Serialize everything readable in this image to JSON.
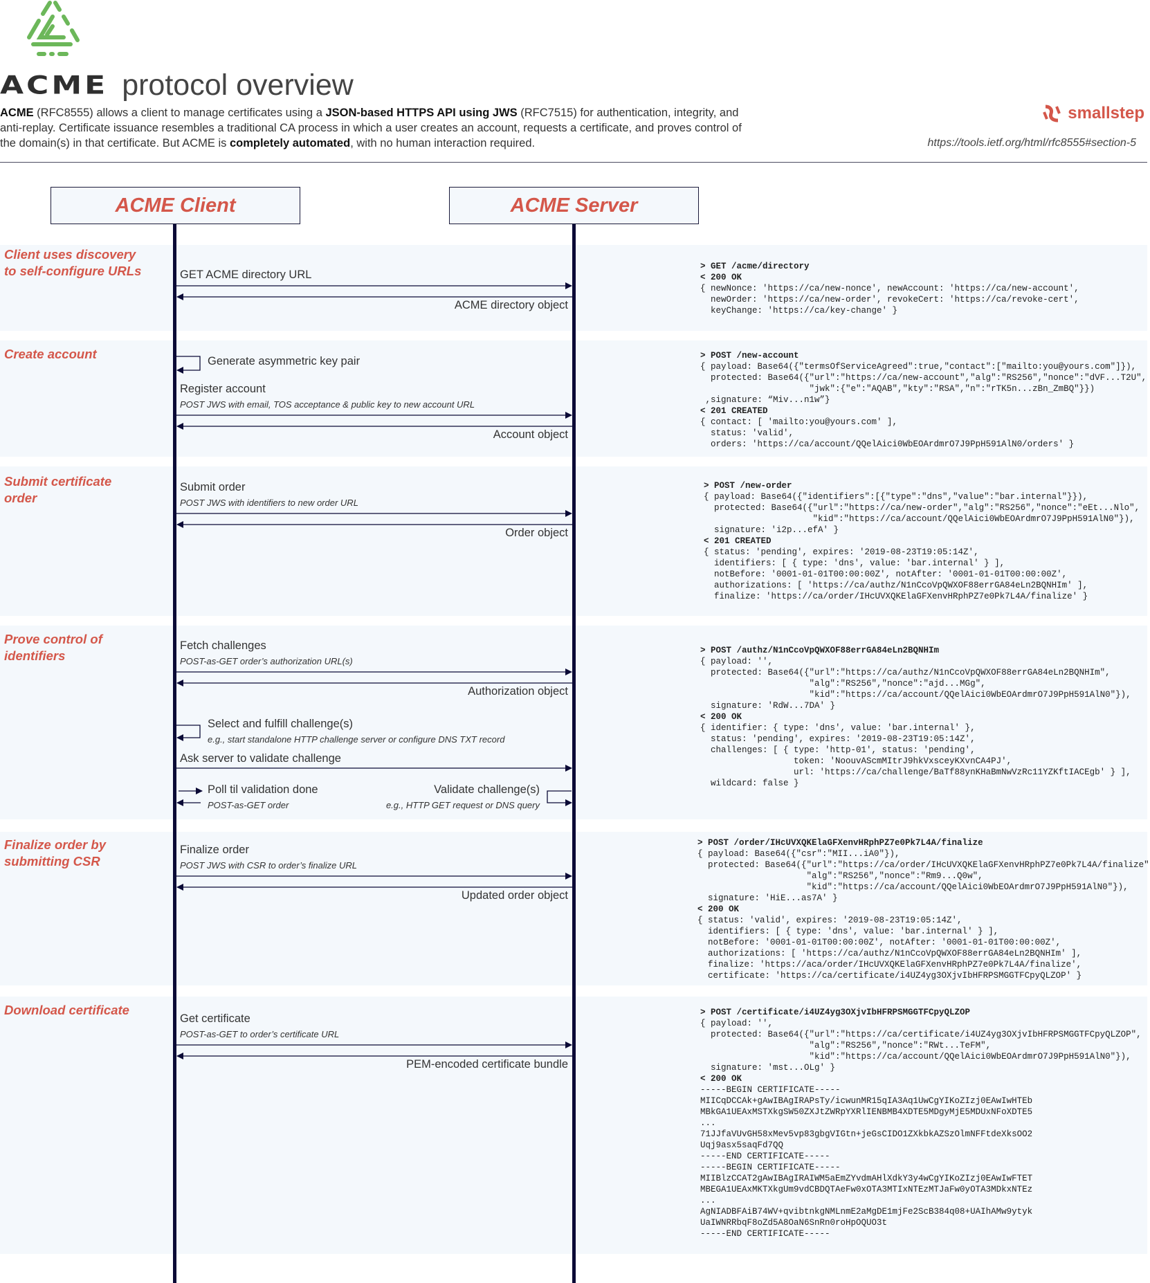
{
  "header": {
    "logo": "acme-triangle-logo",
    "title_word": "ACME",
    "title_rest": "protocol overview",
    "intro": [
      {
        "text": "ACME",
        "bold": true
      },
      {
        "text": " (RFC8555) allows a client to manage certificates using a ",
        "bold": false
      },
      {
        "text": "JSON-based HTTPS API using JWS",
        "bold": true
      },
      {
        "text": " (RFC7515) for authentication, integrity, and anti-replay. Certificate issuance resembles a traditional CA process in which a user creates an account, requests a certificate, and proves control of the domain(s) in that certificate. But ACME is ",
        "bold": false
      },
      {
        "text": "completely automated",
        "bold": true
      },
      {
        "text": ", with no human interaction required.",
        "bold": false
      }
    ],
    "brand": "smallstep",
    "reference_url": "https://tools.ietf.org/html/rfc8555#section-5"
  },
  "colors": {
    "accent": "#d4574a",
    "logo_green": "#6cb75a",
    "lifeline": "#0b0a36",
    "band": "#f4f8fc"
  },
  "actors": {
    "client": "ACME Client",
    "server": "ACME Server"
  },
  "sections": [
    {
      "title": "Client uses discovery to self-configure URLs",
      "messages": [
        {
          "label": "GET ACME directory URL",
          "direction": "to-server"
        },
        {
          "label": "ACME directory object",
          "direction": "to-client"
        }
      ],
      "code": [
        {
          "text": "> GET /acme/directory",
          "bold": true
        },
        {
          "text": "< 200 OK",
          "bold": true
        },
        {
          "text": "{ newNonce: 'https://ca/new-nonce', newAccount: 'https://ca/new-account',",
          "bold": false
        },
        {
          "text": "  newOrder: 'https://ca/new-order', revokeCert: 'https://ca/revoke-cert',",
          "bold": false
        },
        {
          "text": "  keyChange: 'https://ca/key-change' }",
          "bold": false
        }
      ]
    },
    {
      "title": "Create account",
      "messages": [
        {
          "label": "Generate asymmetric key pair",
          "direction": "self-client"
        },
        {
          "label": "Register account",
          "sub": "POST JWS with email, TOS acceptance & public key to new account URL",
          "direction": "to-server"
        },
        {
          "label": "Account object",
          "direction": "to-client"
        }
      ],
      "code": [
        {
          "text": "> POST /new-account",
          "bold": true
        },
        {
          "text": "{ payload: Base64({\"termsOfServiceAgreed\":true,\"contact\":[\"mailto:you@yours.com\"]}),",
          "bold": false
        },
        {
          "text": "  protected: Base64({\"url\":\"https://ca/new-account\",\"alg\":\"RS256\",\"nonce\":\"dVF...T2U\",",
          "bold": false
        },
        {
          "text": "                     \"jwk\":{\"e\":\"AQAB\",\"kty\":\"RSA\",\"n\":\"rTK5n...zBn_ZmBQ\"}})",
          "bold": false
        },
        {
          "text": " ,signature: “Miv...n1w”}",
          "bold": false
        },
        {
          "text": "< 201 CREATED",
          "bold": true
        },
        {
          "text": "{ contact: [ 'mailto:you@yours.com' ],",
          "bold": false
        },
        {
          "text": "  status: 'valid',",
          "bold": false
        },
        {
          "text": "  orders: 'https://ca/account/QQelAici0WbEOArdmrO7J9PpH591AlN0/orders' }",
          "bold": false
        }
      ]
    },
    {
      "title": "Submit certificate order",
      "messages": [
        {
          "label": "Submit order",
          "sub": "POST JWS with identifiers to new order URL",
          "direction": "to-server"
        },
        {
          "label": "Order object",
          "direction": "to-client"
        }
      ],
      "code": [
        {
          "text": "> POST /new-order",
          "bold": true
        },
        {
          "text": "{ payload: Base64({\"identifiers\":[{\"type\":\"dns\",\"value\":\"bar.internal\"}}),",
          "bold": false
        },
        {
          "text": "  protected: Base64({\"url\":\"https://ca/new-order\",\"alg\":\"RS256\",\"nonce\":\"eEt...Nlo\",",
          "bold": false
        },
        {
          "text": "                     \"kid\":\"https://ca/account/QQelAici0WbEOArdmrO7J9PpH591AlN0\"}),",
          "bold": false
        },
        {
          "text": "  signature: 'i2p...efA' }",
          "bold": false
        },
        {
          "text": "< 201 CREATED",
          "bold": true
        },
        {
          "text": "{ status: 'pending', expires: '2019-08-23T19:05:14Z',",
          "bold": false
        },
        {
          "text": "  identifiers: [ { type: 'dns', value: 'bar.internal' } ],",
          "bold": false
        },
        {
          "text": "  notBefore: '0001-01-01T00:00:00Z', notAfter: '0001-01-01T00:00:00Z',",
          "bold": false
        },
        {
          "text": "  authorizations: [ 'https://ca/authz/N1nCcoVpQWXOF88errGA84eLn2BQNHIm' ],",
          "bold": false
        },
        {
          "text": "  finalize: 'https://ca/order/IHcUVXQKElaGFXenvHRphPZ7e0Pk7L4A/finalize' }",
          "bold": false
        }
      ]
    },
    {
      "title": "Prove control of identifiers",
      "messages": [
        {
          "label": "Fetch challenges",
          "sub": "POST-as-GET order’s authorization URL(s)",
          "direction": "to-server"
        },
        {
          "label": "Authorization object",
          "direction": "to-client"
        },
        {
          "label": "Select and fulfill challenge(s)",
          "sub": "e.g., start standalone HTTP challenge server or configure DNS TXT record",
          "direction": "self-client"
        },
        {
          "label": "Ask server to validate challenge",
          "direction": "to-server"
        },
        {
          "label": "Poll til validation done",
          "sub": "POST-as-GET order",
          "direction": "poll-client"
        },
        {
          "label": "Validate challenge(s)",
          "sub": "e.g., HTTP GET request or DNS query",
          "direction": "self-server"
        }
      ],
      "code": [
        {
          "text": "> POST /authz/N1nCcoVpQWXOF88errGA84eLn2BQNHIm",
          "bold": true
        },
        {
          "text": "{ payload: '',",
          "bold": false
        },
        {
          "text": "  protected: Base64({\"url\":\"https://ca/authz/N1nCcoVpQWXOF88errGA84eLn2BQNHIm\",",
          "bold": false
        },
        {
          "text": "                     \"alg\":\"RS256\",\"nonce\":\"ajd...MGg\",",
          "bold": false
        },
        {
          "text": "                     \"kid\":\"https://ca/account/QQelAici0WbEOArdmrO7J9PpH591AlN0\"}),",
          "bold": false
        },
        {
          "text": "  signature: 'RdW...7DA' }",
          "bold": false
        },
        {
          "text": "< 200 OK",
          "bold": true
        },
        {
          "text": "{ identifier: { type: 'dns', value: 'bar.internal' },",
          "bold": false
        },
        {
          "text": "  status: 'pending', expires: '2019-08-23T19:05:14Z',",
          "bold": false
        },
        {
          "text": "  challenges: [ { type: 'http-01', status: 'pending',",
          "bold": false
        },
        {
          "text": "                  token: 'NoouvAScmMItrJ9hkVxsceyKXvnCA4PJ',",
          "bold": false
        },
        {
          "text": "                  url: 'https://ca/challenge/BaTf88ynKHaBmNwVzRc11YZKftIACEgb' } ],",
          "bold": false
        },
        {
          "text": "  wildcard: false }",
          "bold": false
        }
      ]
    },
    {
      "title": "Finalize order by submitting CSR",
      "messages": [
        {
          "label": "Finalize order",
          "sub": "POST JWS with CSR to order’s finalize URL",
          "direction": "to-server"
        },
        {
          "label": "Updated order object",
          "direction": "to-client"
        }
      ],
      "code": [
        {
          "text": "> POST /order/IHcUVXQKElaGFXenvHRphPZ7e0Pk7L4A/finalize",
          "bold": true
        },
        {
          "text": "{ payload: Base64({\"csr\":\"MII...iA0\"}),",
          "bold": false
        },
        {
          "text": "  protected: Base64({\"url\":\"https://ca/order/IHcUVXQKElaGFXenvHRphPZ7e0Pk7L4A/finalize\",",
          "bold": false
        },
        {
          "text": "                     \"alg\":\"RS256\",\"nonce\":\"Rm9...Q0w\",",
          "bold": false
        },
        {
          "text": "                     \"kid\":\"https://ca/account/QQelAici0WbEOArdmrO7J9PpH591AlN0\"}),",
          "bold": false
        },
        {
          "text": "  signature: 'HiE...as7A' }",
          "bold": false
        },
        {
          "text": "< 200 OK",
          "bold": true
        },
        {
          "text": "{ status: 'valid', expires: '2019-08-23T19:05:14Z',",
          "bold": false
        },
        {
          "text": "  identifiers: [ { type: 'dns', value: 'bar.internal' } ],",
          "bold": false
        },
        {
          "text": "  notBefore: '0001-01-01T00:00:00Z', notAfter: '0001-01-01T00:00:00Z',",
          "bold": false
        },
        {
          "text": "  authorizations: [ 'https://ca/authz/N1nCcoVpQWXOF88errGA84eLn2BQNHIm' ],",
          "bold": false
        },
        {
          "text": "  finalize: 'https://aca/order/IHcUVXQKElaGFXenvHRphPZ7e0Pk7L4A/finalize',",
          "bold": false
        },
        {
          "text": "  certificate: 'https://ca/certificate/i4UZ4yg3OXjvIbHFRPSMGGTFCpyQLZOP' }",
          "bold": false
        }
      ]
    },
    {
      "title": "Download certificate",
      "messages": [
        {
          "label": "Get certificate",
          "sub": "POST-as-GET to order’s certificate URL",
          "direction": "to-server"
        },
        {
          "label": "PEM-encoded certificate bundle",
          "direction": "to-client"
        }
      ],
      "code": [
        {
          "text": "> POST /certificate/i4UZ4yg3OXjvIbHFRPSMGGTFCpyQLZOP",
          "bold": true
        },
        {
          "text": "{ payload: '',",
          "bold": false
        },
        {
          "text": "  protected: Base64({\"url\":\"https://ca/certificate/i4UZ4yg3OXjvIbHFRPSMGGTFCpyQLZOP\",",
          "bold": false
        },
        {
          "text": "                     \"alg\":\"RS256\",\"nonce\":\"RWt...TeFM\",",
          "bold": false
        },
        {
          "text": "                     \"kid\":\"https://ca/account/QQelAici0WbEOArdmrO7J9PpH591AlN0\"}),",
          "bold": false
        },
        {
          "text": "  signature: 'mst...OLg' }",
          "bold": false
        },
        {
          "text": "< 200 OK",
          "bold": true
        },
        {
          "text": "-----BEGIN CERTIFICATE-----",
          "bold": false
        },
        {
          "text": "MIICqDCCAk+gAwIBAgIRAPsTy/icwunMR15qIA3Aq1UwCgYIKoZIzj0EAwIwHTEb",
          "bold": false
        },
        {
          "text": "MBkGA1UEAxMSTXkgSW50ZXJtZWRpYXRlIENBMB4XDTE5MDgyMjE5MDUxNFoXDTE5",
          "bold": false
        },
        {
          "text": "...",
          "bold": false
        },
        {
          "text": "71JJfaVUvGH58xMev5vp83gbgVIGtn+jeGsCIDO1ZXkbkAZSzOlmNFFtdeXksOO2",
          "bold": false
        },
        {
          "text": "Uqj9asx5saqFd7QQ",
          "bold": false
        },
        {
          "text": "-----END CERTIFICATE-----",
          "bold": false
        },
        {
          "text": "-----BEGIN CERTIFICATE-----",
          "bold": false
        },
        {
          "text": "MIIBlzCCAT2gAwIBAgIRAIWM5aEmZYvdmAHlXdkY3y4wCgYIKoZIzj0EAwIwFTET",
          "bold": false
        },
        {
          "text": "MBEGA1UEAxMKTXkgUm9vdCBDQTAeFw0xOTA3MTIxNTEzMTJaFw0yOTA3MDkxNTEz",
          "bold": false
        },
        {
          "text": "...",
          "bold": false
        },
        {
          "text": "AgNIADBFAiB74WV+qvibtnkgNMLnmE2aMgDE1mjFe2ScB384q08+UAIhAMw9ytyk",
          "bold": false
        },
        {
          "text": "UaIWNRRbqF8oZd5A8OaN6SnRn0roHpOQUO3t",
          "bold": false
        },
        {
          "text": "-----END CERTIFICATE-----",
          "bold": false
        }
      ]
    }
  ]
}
